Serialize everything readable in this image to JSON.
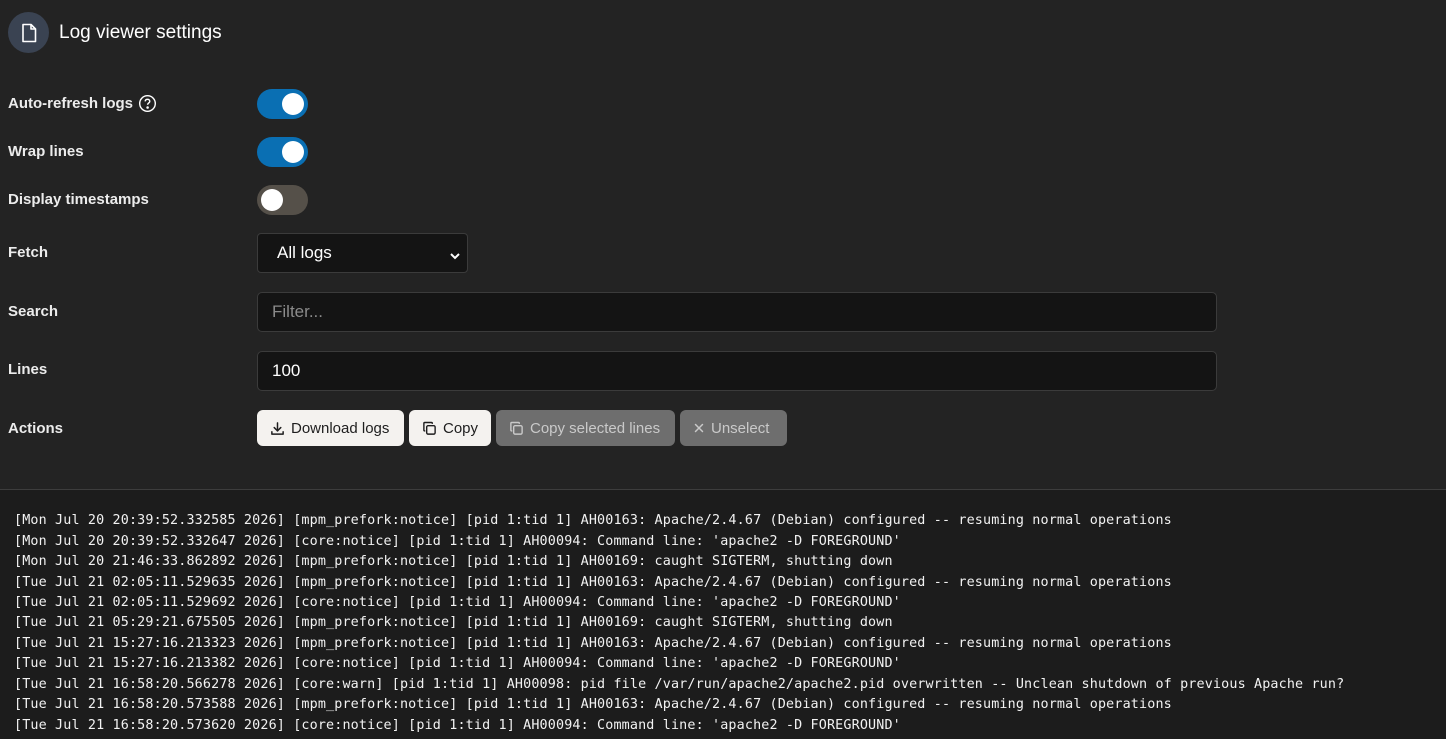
{
  "header": {
    "title": "Log viewer settings",
    "icon": "file-icon"
  },
  "settings": {
    "auto_refresh": {
      "label": "Auto-refresh logs",
      "enabled": true
    },
    "wrap_lines": {
      "label": "Wrap lines",
      "enabled": true
    },
    "display_timestamps": {
      "label": "Display timestamps",
      "enabled": false
    },
    "fetch": {
      "label": "Fetch",
      "selected": "All logs"
    },
    "search": {
      "label": "Search",
      "placeholder": "Filter...",
      "value": ""
    },
    "lines": {
      "label": "Lines",
      "value": "100"
    },
    "actions": {
      "label": "Actions",
      "download": "Download logs",
      "copy": "Copy",
      "copy_selected": "Copy selected lines",
      "unselect": "Unselect"
    }
  },
  "colors": {
    "background": "#232323",
    "log_background": "#1c1c1c",
    "toggle_on": "#0a6fb3",
    "toggle_off": "#555049"
  },
  "logs": [
    "[Mon Jul 20 20:39:52.332585 2026] [mpm_prefork:notice] [pid 1:tid 1] AH00163: Apache/2.4.67 (Debian) configured -- resuming normal operations",
    "[Mon Jul 20 20:39:52.332647 2026] [core:notice] [pid 1:tid 1] AH00094: Command line: 'apache2 -D FOREGROUND'",
    "[Mon Jul 20 21:46:33.862892 2026] [mpm_prefork:notice] [pid 1:tid 1] AH00169: caught SIGTERM, shutting down",
    "[Tue Jul 21 02:05:11.529635 2026] [mpm_prefork:notice] [pid 1:tid 1] AH00163: Apache/2.4.67 (Debian) configured -- resuming normal operations",
    "[Tue Jul 21 02:05:11.529692 2026] [core:notice] [pid 1:tid 1] AH00094: Command line: 'apache2 -D FOREGROUND'",
    "[Tue Jul 21 05:29:21.675505 2026] [mpm_prefork:notice] [pid 1:tid 1] AH00169: caught SIGTERM, shutting down",
    "[Tue Jul 21 15:27:16.213323 2026] [mpm_prefork:notice] [pid 1:tid 1] AH00163: Apache/2.4.67 (Debian) configured -- resuming normal operations",
    "[Tue Jul 21 15:27:16.213382 2026] [core:notice] [pid 1:tid 1] AH00094: Command line: 'apache2 -D FOREGROUND'",
    "[Tue Jul 21 16:58:20.566278 2026] [core:warn] [pid 1:tid 1] AH00098: pid file /var/run/apache2/apache2.pid overwritten -- Unclean shutdown of previous Apache run?",
    "[Tue Jul 21 16:58:20.573588 2026] [mpm_prefork:notice] [pid 1:tid 1] AH00163: Apache/2.4.67 (Debian) configured -- resuming normal operations",
    "[Tue Jul 21 16:58:20.573620 2026] [core:notice] [pid 1:tid 1] AH00094: Command line: 'apache2 -D FOREGROUND'"
  ]
}
